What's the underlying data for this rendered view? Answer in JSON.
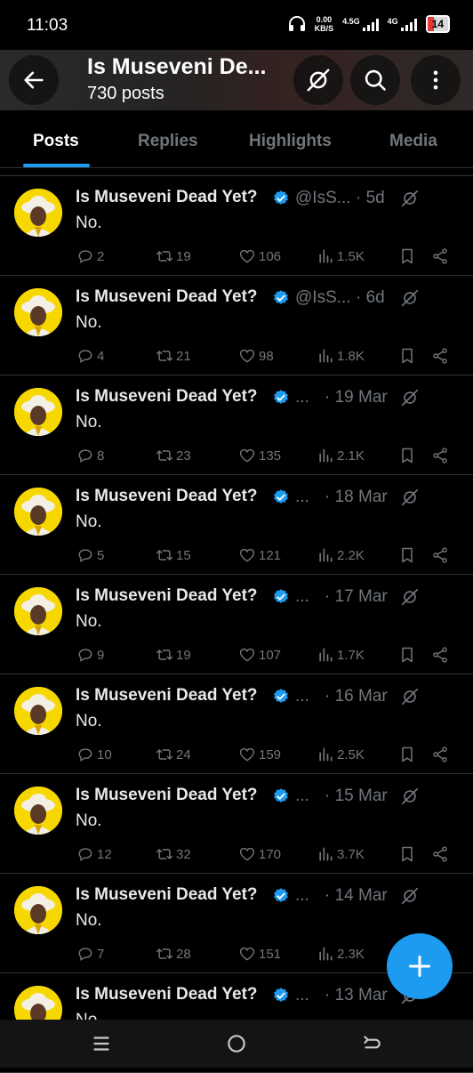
{
  "status": {
    "time": "11:03",
    "speed_value": "0.00",
    "speed_unit": "KB/S",
    "net1": "4.5G",
    "net2": "4G",
    "battery": "14"
  },
  "header": {
    "title": "Is Museveni De...",
    "posts_count": "730 posts"
  },
  "tabs": [
    "Posts",
    "Replies",
    "Highlights",
    "Media"
  ],
  "tweets": [
    {
      "name": "Is Museveni Dead Yet?",
      "handle": "@IsS...",
      "date": "· 5d",
      "body": "No.",
      "replies": "2",
      "retweets": "19",
      "likes": "106",
      "views": "1.5K"
    },
    {
      "name": "Is Museveni Dead Yet?",
      "handle": "@IsS...",
      "date": "· 6d",
      "body": "No.",
      "replies": "4",
      "retweets": "21",
      "likes": "98",
      "views": "1.8K"
    },
    {
      "name": "Is Museveni Dead Yet?",
      "handle": "...",
      "date": "· 19 Mar",
      "body": "No.",
      "replies": "8",
      "retweets": "23",
      "likes": "135",
      "views": "2.1K"
    },
    {
      "name": "Is Museveni Dead Yet?",
      "handle": "...",
      "date": "· 18 Mar",
      "body": "No.",
      "replies": "5",
      "retweets": "15",
      "likes": "121",
      "views": "2.2K"
    },
    {
      "name": "Is Museveni Dead Yet?",
      "handle": "...",
      "date": "· 17 Mar",
      "body": "No.",
      "replies": "9",
      "retweets": "19",
      "likes": "107",
      "views": "1.7K"
    },
    {
      "name": "Is Museveni Dead Yet?",
      "handle": "...",
      "date": "· 16 Mar",
      "body": "No.",
      "replies": "10",
      "retweets": "24",
      "likes": "159",
      "views": "2.5K"
    },
    {
      "name": "Is Museveni Dead Yet?",
      "handle": "...",
      "date": "· 15 Mar",
      "body": "No.",
      "replies": "12",
      "retweets": "32",
      "likes": "170",
      "views": "3.7K"
    },
    {
      "name": "Is Museveni Dead Yet?",
      "handle": "...",
      "date": "· 14 Mar",
      "body": "No.",
      "replies": "7",
      "retweets": "28",
      "likes": "151",
      "views": "2.3K"
    },
    {
      "name": "Is Museveni Dead Yet?",
      "handle": "...",
      "date": "· 13 Mar",
      "body": "No.",
      "replies": "",
      "retweets": "",
      "likes": "",
      "views": ""
    }
  ],
  "icons": {
    "back": "arrow-left-icon",
    "grok": "grok-icon",
    "search": "search-icon",
    "more": "more-vertical-icon",
    "reply": "reply-icon",
    "retweet": "retweet-icon",
    "like": "heart-icon",
    "views": "views-icon",
    "bookmark": "bookmark-icon",
    "share": "share-icon",
    "compose": "plus-icon",
    "nav_menu": "menu-icon",
    "nav_home": "home-circle-icon",
    "nav_back": "back-icon"
  },
  "colors": {
    "accent": "#1d9bf0",
    "muted": "#71767b",
    "text": "#e7e9ea",
    "background": "#000000"
  }
}
